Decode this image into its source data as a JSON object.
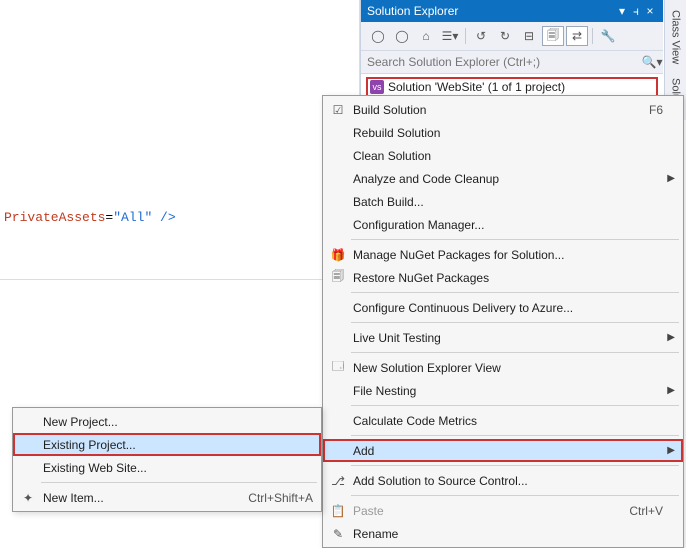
{
  "editor": {
    "attr_name": "PrivateAssets",
    "eq": "=",
    "attr_val": "\"All\"",
    "close": " />"
  },
  "solution_explorer": {
    "title": "Solution Explorer",
    "search_placeholder": "Search Solution Explorer (Ctrl+;)",
    "solution_node": "Solution 'WebSite' (1 of 1 project)"
  },
  "side_tabs": {
    "class_view": "Class View",
    "solution": "Solu"
  },
  "context_menu": {
    "build": "Build Solution",
    "build_key": "F6",
    "rebuild": "Rebuild Solution",
    "clean": "Clean Solution",
    "analyze": "Analyze and Code Cleanup",
    "batch": "Batch Build...",
    "config": "Configuration Manager...",
    "nuget_manage": "Manage NuGet Packages for Solution...",
    "nuget_restore": "Restore NuGet Packages",
    "azure": "Configure Continuous Delivery to Azure...",
    "live_test": "Live Unit Testing",
    "new_view": "New Solution Explorer View",
    "nesting": "File Nesting",
    "metrics": "Calculate Code Metrics",
    "add": "Add",
    "source_control": "Add Solution to Source Control...",
    "paste": "Paste",
    "paste_key": "Ctrl+V",
    "rename": "Rename"
  },
  "add_submenu": {
    "new_project": "New Project...",
    "existing_project": "Existing Project...",
    "existing_web": "Existing Web Site...",
    "new_item": "New Item...",
    "new_item_key": "Ctrl+Shift+A"
  }
}
